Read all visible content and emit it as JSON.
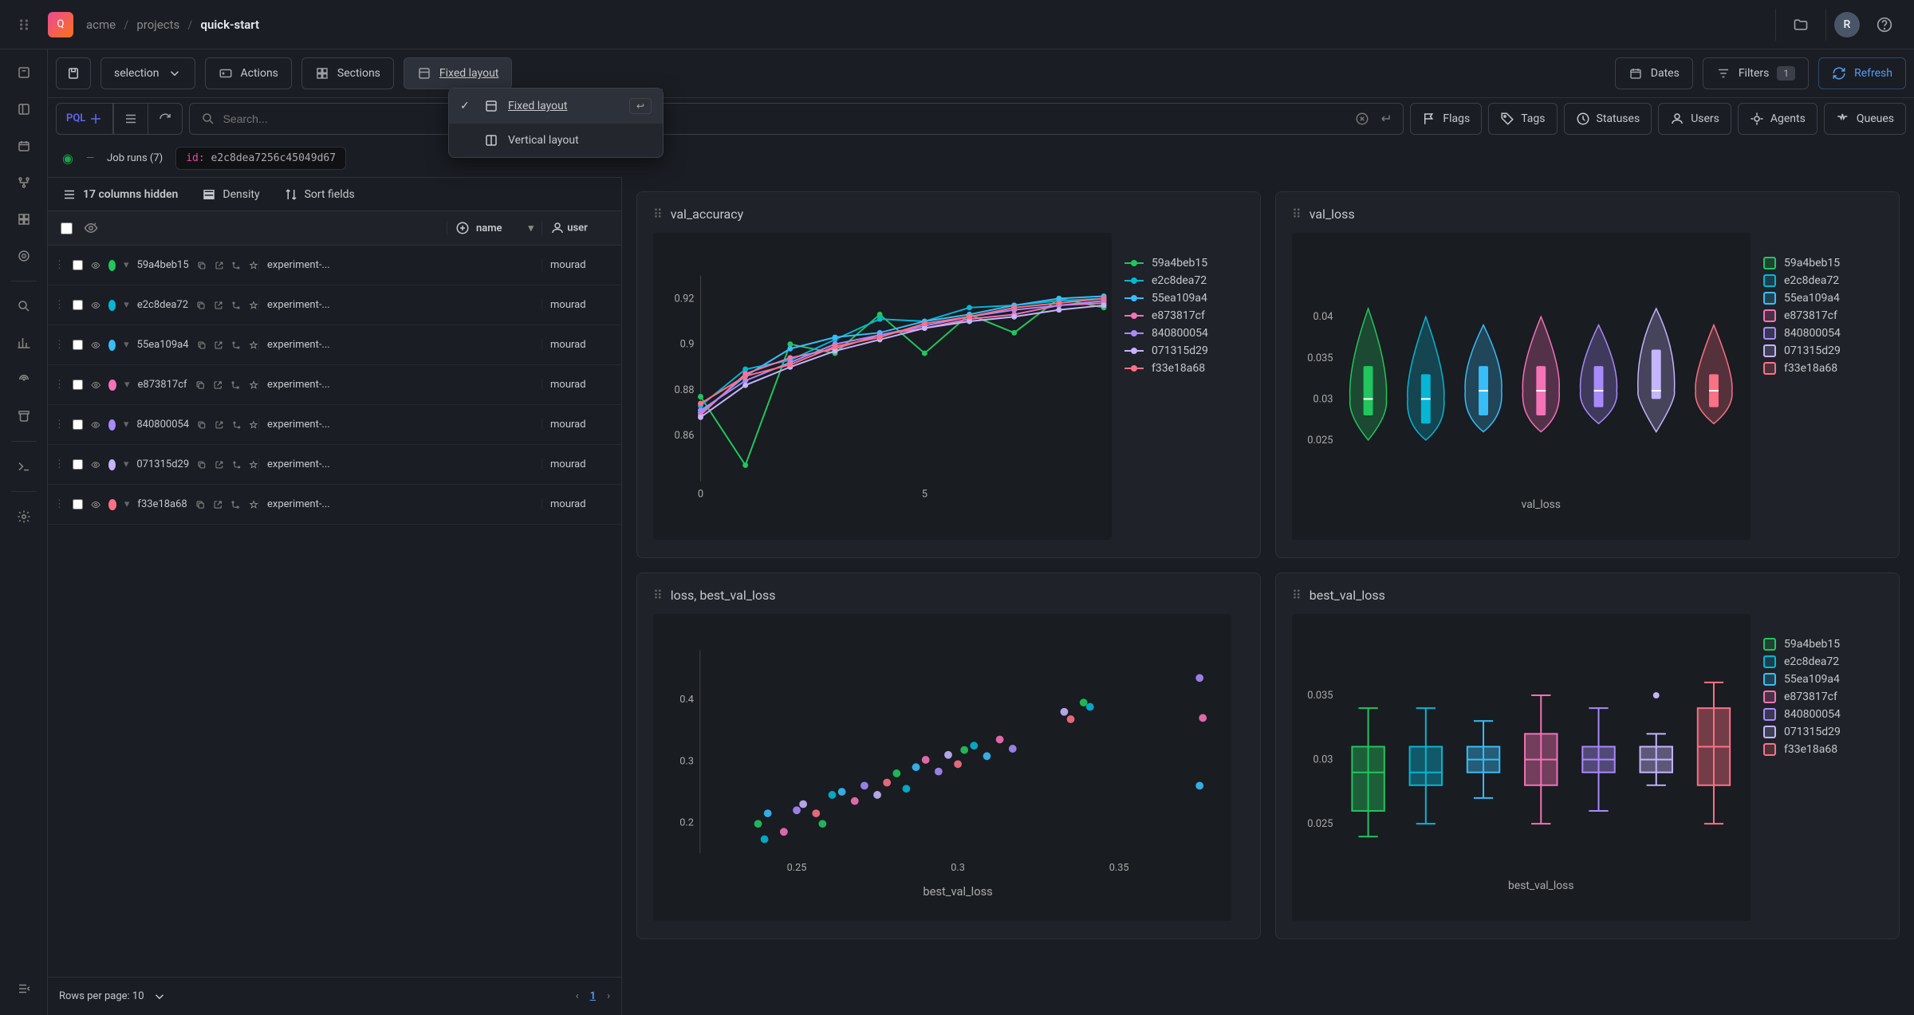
{
  "header": {
    "logo_letter": "Q",
    "breadcrumb": [
      "acme",
      "projects",
      "quick-start"
    ],
    "avatar": "R"
  },
  "toolbar": {
    "selection": "selection",
    "actions": "Actions",
    "sections": "Sections",
    "fixed_layout": "Fixed layout",
    "dates": "Dates",
    "filters": "Filters",
    "filters_badge": "1",
    "refresh": "Refresh"
  },
  "layout_menu": {
    "items": [
      {
        "label": "Fixed layout",
        "selected": true,
        "kbd": "↩"
      },
      {
        "label": "Vertical layout",
        "selected": false
      }
    ]
  },
  "filters": {
    "pql": "PQL",
    "search_placeholder": "Search...",
    "tabs": [
      "Flags",
      "Tags",
      "Statuses",
      "Users",
      "Agents",
      "Queues"
    ]
  },
  "query": {
    "label": "Job runs (7)",
    "code_key": "id:",
    "code_val": "e2c8dea7256c45049d67"
  },
  "table": {
    "hidden_cols": "17 columns hidden",
    "density": "Density",
    "sort": "Sort fields",
    "col_name": "name",
    "col_user": "user",
    "rows_per_page": "Rows per page: 10",
    "page": "1",
    "rows": [
      {
        "hash": "59a4beb15",
        "color": "#22c55e",
        "name": "experiment-...",
        "user": "mourad"
      },
      {
        "hash": "e2c8dea72",
        "color": "#06b6d4",
        "name": "experiment-...",
        "user": "mourad"
      },
      {
        "hash": "55ea109a4",
        "color": "#38bdf8",
        "name": "experiment-...",
        "user": "mourad"
      },
      {
        "hash": "e873817cf",
        "color": "#f472b6",
        "name": "experiment-...",
        "user": "mourad"
      },
      {
        "hash": "840800054",
        "color": "#a78bfa",
        "name": "experiment-...",
        "user": "mourad"
      },
      {
        "hash": "071315d29",
        "color": "#c4b5fd",
        "name": "experiment-...",
        "user": "mourad"
      },
      {
        "hash": "f33e18a68",
        "color": "#fb7185",
        "name": "experiment-...",
        "user": "mourad"
      }
    ]
  },
  "charts": {
    "titles": {
      "a": "val_accuracy",
      "b": "val_loss",
      "c": "loss, best_val_loss",
      "d": "best_val_loss"
    },
    "val_loss_xlabel": "val_loss",
    "best_val_loss_ylabel": "best_val_loss",
    "best_val_loss_xlabel": "best_val_loss",
    "legend": [
      {
        "name": "59a4beb15",
        "color": "#22c55e"
      },
      {
        "name": "e2c8dea72",
        "color": "#06b6d4"
      },
      {
        "name": "55ea109a4",
        "color": "#38bdf8"
      },
      {
        "name": "e873817cf",
        "color": "#f472b6"
      },
      {
        "name": "840800054",
        "color": "#a78bfa"
      },
      {
        "name": "071315d29",
        "color": "#c4b5fd"
      },
      {
        "name": "f33e18a68",
        "color": "#fb7185"
      }
    ]
  },
  "chart_data": [
    {
      "type": "line",
      "title": "val_accuracy",
      "x": [
        0,
        1,
        2,
        3,
        4,
        5,
        6,
        7,
        8,
        9
      ],
      "xlim": [
        0,
        9
      ],
      "ylim": [
        0.84,
        0.93
      ],
      "y_ticks": [
        0.86,
        0.88,
        0.9,
        0.92
      ],
      "x_ticks": [
        0,
        5
      ],
      "series": [
        {
          "name": "59a4beb15",
          "values": [
            0.877,
            0.847,
            0.9,
            0.896,
            0.913,
            0.896,
            0.913,
            0.905,
            0.92,
            0.916
          ]
        },
        {
          "name": "e2c8dea72",
          "values": [
            0.873,
            0.889,
            0.893,
            0.902,
            0.911,
            0.91,
            0.916,
            0.917,
            0.919,
            0.92
          ]
        },
        {
          "name": "55ea109a4",
          "values": [
            0.87,
            0.886,
            0.898,
            0.903,
            0.905,
            0.91,
            0.913,
            0.917,
            0.92,
            0.921
          ]
        },
        {
          "name": "e873817cf",
          "values": [
            0.869,
            0.887,
            0.894,
            0.898,
            0.904,
            0.907,
            0.911,
            0.913,
            0.917,
            0.918
          ]
        },
        {
          "name": "840800054",
          "values": [
            0.871,
            0.884,
            0.892,
            0.9,
            0.904,
            0.908,
            0.912,
            0.915,
            0.917,
            0.919
          ]
        },
        {
          "name": "071315d29",
          "values": [
            0.868,
            0.882,
            0.89,
            0.897,
            0.902,
            0.907,
            0.91,
            0.912,
            0.915,
            0.917
          ]
        },
        {
          "name": "f33e18a68",
          "values": [
            0.874,
            0.886,
            0.891,
            0.899,
            0.903,
            0.909,
            0.912,
            0.916,
            0.918,
            0.92
          ]
        }
      ]
    },
    {
      "type": "violin",
      "title": "val_loss",
      "xlabel": "val_loss",
      "y_ticks": [
        0.025,
        0.03,
        0.035,
        0.04
      ],
      "ylim": [
        0.02,
        0.045
      ],
      "series": [
        {
          "name": "59a4beb15",
          "median": 0.03,
          "q1": 0.028,
          "q3": 0.034,
          "min": 0.025,
          "max": 0.041
        },
        {
          "name": "e2c8dea72",
          "median": 0.03,
          "q1": 0.027,
          "q3": 0.033,
          "min": 0.025,
          "max": 0.04
        },
        {
          "name": "55ea109a4",
          "median": 0.031,
          "q1": 0.028,
          "q3": 0.034,
          "min": 0.026,
          "max": 0.039
        },
        {
          "name": "e873817cf",
          "median": 0.031,
          "q1": 0.028,
          "q3": 0.034,
          "min": 0.026,
          "max": 0.04
        },
        {
          "name": "840800054",
          "median": 0.031,
          "q1": 0.029,
          "q3": 0.034,
          "min": 0.027,
          "max": 0.039
        },
        {
          "name": "071315d29",
          "median": 0.031,
          "q1": 0.03,
          "q3": 0.036,
          "min": 0.026,
          "max": 0.041
        },
        {
          "name": "f33e18a68",
          "median": 0.031,
          "q1": 0.029,
          "q3": 0.033,
          "min": 0.027,
          "max": 0.039
        }
      ]
    },
    {
      "type": "scatter",
      "title": "loss, best_val_loss",
      "xlabel": "best_val_loss",
      "xlim": [
        0.22,
        0.38
      ],
      "ylim": [
        0.15,
        0.48
      ],
      "x_ticks": [
        0.25,
        0.3,
        0.35
      ],
      "y_ticks": [
        0.2,
        0.3,
        0.4
      ],
      "points": [
        {
          "x": 0.238,
          "y": 0.198
        },
        {
          "x": 0.24,
          "y": 0.173
        },
        {
          "x": 0.241,
          "y": 0.215
        },
        {
          "x": 0.246,
          "y": 0.185
        },
        {
          "x": 0.25,
          "y": 0.22
        },
        {
          "x": 0.252,
          "y": 0.23
        },
        {
          "x": 0.256,
          "y": 0.215
        },
        {
          "x": 0.258,
          "y": 0.198
        },
        {
          "x": 0.261,
          "y": 0.245
        },
        {
          "x": 0.264,
          "y": 0.25
        },
        {
          "x": 0.268,
          "y": 0.235
        },
        {
          "x": 0.271,
          "y": 0.26
        },
        {
          "x": 0.275,
          "y": 0.245
        },
        {
          "x": 0.278,
          "y": 0.265
        },
        {
          "x": 0.281,
          "y": 0.28
        },
        {
          "x": 0.284,
          "y": 0.255
        },
        {
          "x": 0.287,
          "y": 0.29
        },
        {
          "x": 0.29,
          "y": 0.302
        },
        {
          "x": 0.294,
          "y": 0.283
        },
        {
          "x": 0.297,
          "y": 0.31
        },
        {
          "x": 0.3,
          "y": 0.295
        },
        {
          "x": 0.302,
          "y": 0.318
        },
        {
          "x": 0.305,
          "y": 0.325
        },
        {
          "x": 0.309,
          "y": 0.308
        },
        {
          "x": 0.313,
          "y": 0.335
        },
        {
          "x": 0.317,
          "y": 0.32
        },
        {
          "x": 0.333,
          "y": 0.38
        },
        {
          "x": 0.335,
          "y": 0.368
        },
        {
          "x": 0.339,
          "y": 0.395
        },
        {
          "x": 0.341,
          "y": 0.388
        },
        {
          "x": 0.375,
          "y": 0.26
        },
        {
          "x": 0.376,
          "y": 0.37
        },
        {
          "x": 0.375,
          "y": 0.435
        }
      ]
    },
    {
      "type": "box",
      "title": "best_val_loss",
      "xlabel": "best_val_loss",
      "y_ticks": [
        0.025,
        0.03,
        0.035
      ],
      "ylim": [
        0.022,
        0.038
      ],
      "series": [
        {
          "name": "59a4beb15",
          "median": 0.029,
          "q1": 0.026,
          "q3": 0.031,
          "min": 0.024,
          "max": 0.034
        },
        {
          "name": "e2c8dea72",
          "median": 0.029,
          "q1": 0.028,
          "q3": 0.031,
          "min": 0.025,
          "max": 0.034
        },
        {
          "name": "55ea109a4",
          "median": 0.03,
          "q1": 0.029,
          "q3": 0.031,
          "min": 0.027,
          "max": 0.033
        },
        {
          "name": "e873817cf",
          "median": 0.03,
          "q1": 0.028,
          "q3": 0.032,
          "min": 0.025,
          "max": 0.035
        },
        {
          "name": "840800054",
          "median": 0.03,
          "q1": 0.029,
          "q3": 0.031,
          "min": 0.026,
          "max": 0.034
        },
        {
          "name": "071315d29",
          "median": 0.03,
          "q1": 0.029,
          "q3": 0.031,
          "min": 0.028,
          "max": 0.032,
          "outlier": 0.035
        },
        {
          "name": "f33e18a68",
          "median": 0.031,
          "q1": 0.028,
          "q3": 0.034,
          "min": 0.025,
          "max": 0.036
        }
      ]
    }
  ]
}
